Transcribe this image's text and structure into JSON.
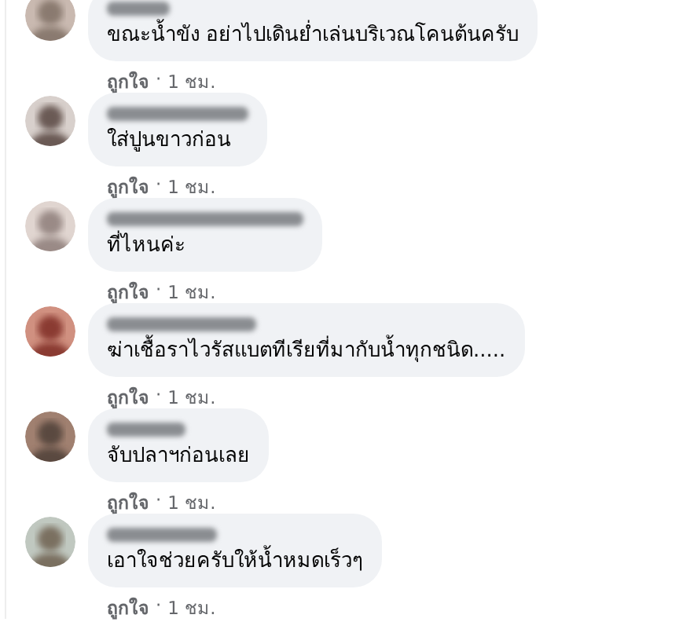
{
  "comments": [
    {
      "text": "ขณะน้ำขัง อย่าไปเดินย่ำเล่นบริเวณโคนต้นครับ",
      "like": "ถูกใจ",
      "separator": "·",
      "time": "1 ชม."
    },
    {
      "text": "ใส่ปูนขาวก่อน",
      "like": "ถูกใจ",
      "separator": "·",
      "time": "1 ชม."
    },
    {
      "text": "ที่ไหนค่ะ",
      "like": "ถูกใจ",
      "separator": "·",
      "time": "1 ชม."
    },
    {
      "text": "ฆ่าเชื้อราไวรัสแบตทีเรียที่มากับน้ำทุกชนิด.....",
      "like": "ถูกใจ",
      "separator": "·",
      "time": "1 ชม."
    },
    {
      "text": "จับปลาฯก่อนเลย",
      "like": "ถูกใจ",
      "separator": "·",
      "time": "1 ชม."
    },
    {
      "text": "เอาใจช่วยครับให้น้ำหมดเร็วๆ",
      "like": "ถูกใจ",
      "separator": "·",
      "time": "1 ชม."
    }
  ]
}
